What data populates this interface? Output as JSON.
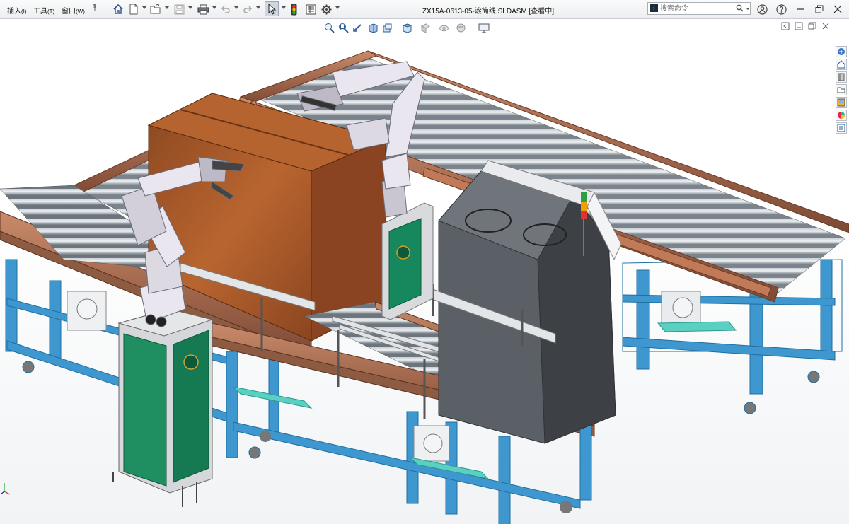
{
  "menu": {
    "insert": "插入",
    "insert_key": "(I)",
    "tools": "工具",
    "tools_key": "(T)",
    "window": "窗口",
    "window_key": "(W)"
  },
  "document": {
    "title": "ZX15A-0613-05-滚筒线.SLDASM [查看中]"
  },
  "search": {
    "placeholder": "搜索命令"
  },
  "toolbar_icons": [
    "home-icon",
    "new-document-icon",
    "open-folder-icon",
    "save-icon",
    "print-icon",
    "undo-icon",
    "redo-icon",
    "select-pointer-icon",
    "traffic-light-icon",
    "file-properties-icon",
    "options-gear-icon"
  ],
  "heads_up_icons": [
    "zoom-to-fit-icon",
    "zoom-area-icon",
    "previous-view-icon",
    "section-view-icon",
    "dynamic-annotation-icon",
    "view-orientation-icon",
    "display-style-icon",
    "hide-show-icon",
    "edit-appearance-icon",
    "apply-scene-icon",
    "view-settings-icon"
  ],
  "task_pane_icons": [
    "solidworks-resources-icon",
    "design-library-icon",
    "file-explorer-icon",
    "view-palette-icon",
    "appearances-icon",
    "custom-properties-icon",
    "property-list-icon"
  ],
  "colors": {
    "frame_blue": "#3f97cf",
    "rail_wood": "#9a5b3b",
    "roller_grey": "#9aa3ab",
    "box_wood": "#a9582a",
    "cabinet_green": "#17885e",
    "machine_grey": "#4b4f54",
    "robot_white": "#e9e6ef"
  }
}
